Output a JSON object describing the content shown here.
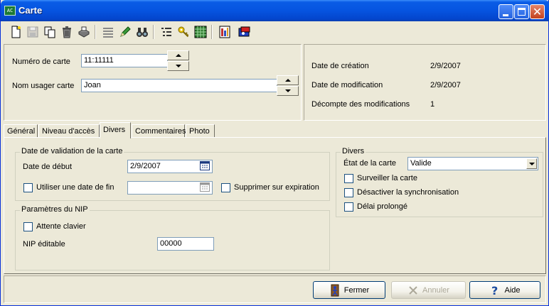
{
  "window": {
    "title": "Carte",
    "app_icon_text": "AC"
  },
  "toolbar": {
    "icons": [
      "new-document-icon",
      "save-disk-icon",
      "copy-pages-icon",
      "trash-icon",
      "print-icon",
      "list-icon",
      "edit-pencil-icon",
      "binoculars-icon",
      "tree-list-icon",
      "key-icon",
      "grid-icon",
      "report-icon",
      "card-reader-icon"
    ]
  },
  "card": {
    "number_label": "Numéro de carte",
    "number_value": "11:11111",
    "user_label": "Nom usager carte",
    "user_value": "Joan"
  },
  "info": {
    "created_label": "Date de création",
    "created_value": "2/9/2007",
    "modified_label": "Date de modification",
    "modified_value": "2/9/2007",
    "count_label": "Décompte des modifications",
    "count_value": "1"
  },
  "tabs": [
    {
      "label": "Général"
    },
    {
      "label": "Niveau d'accès"
    },
    {
      "label": "Divers"
    },
    {
      "label": "Commentaires"
    },
    {
      "label": "Photo"
    }
  ],
  "validation": {
    "title": "Date de validation de la carte",
    "start_label": "Date de début",
    "start_value": "2/9/2007",
    "end_check_label": "Utiliser une date de fin",
    "end_value": "",
    "delete_check_label": "Supprimer sur expiration"
  },
  "nip": {
    "title": "Paramètres du NIP",
    "wait_label": "Attente clavier",
    "editable_label": "NIP éditable",
    "editable_value": "00000"
  },
  "misc": {
    "title": "Divers",
    "state_label": "État de la carte",
    "state_value": "Valide",
    "watch_label": "Surveiller la carte",
    "sync_label": "Désactiver la synchronisation",
    "delay_label": "Délai prolongé"
  },
  "buttons": {
    "close_label": "Fermer",
    "cancel_label": "Annuler",
    "help_label": "Aide"
  }
}
